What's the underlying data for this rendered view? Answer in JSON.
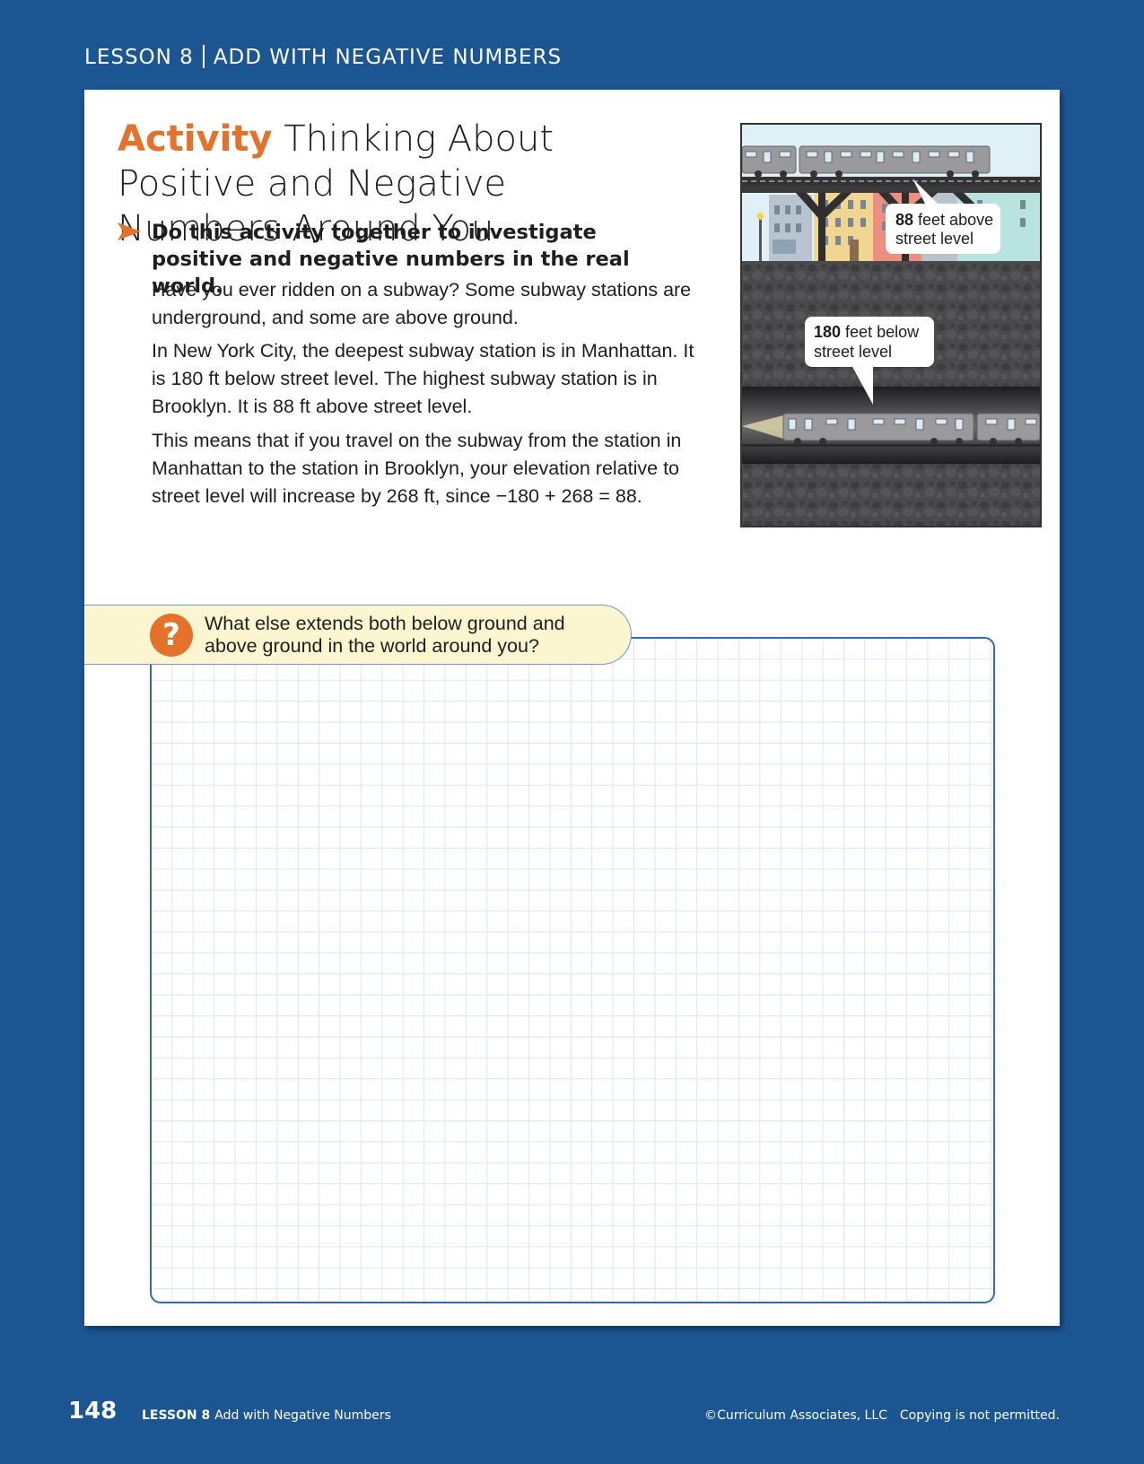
{
  "header": {
    "lesson_label": "LESSON 8",
    "lesson_title": "ADD WITH NEGATIVE NUMBERS"
  },
  "activity": {
    "label": "Activity",
    "title": "Thinking About Positive and Negative Numbers Around You",
    "instruction": "Do this activity together to investigate positive and negative numbers in the real world.",
    "paragraphs": [
      "Have you ever ridden on a subway? Some subway stations are underground, and some are above ground.",
      "In New York City, the deepest subway station is in Manhattan. It is 180 ft below street level. The highest subway station is in Brooklyn. It is 88 ft above street level.",
      "This means that if you travel on the subway from the station in Manhattan to the station in Brooklyn, your elevation relative to street level will increase by 268 ft, since −180 + 268 = 88."
    ]
  },
  "illustration": {
    "above_bold": "88",
    "above_rest": " feet above",
    "above_line2": "street level",
    "below_bold": "180",
    "below_rest": " feet below",
    "below_line2": "street level"
  },
  "prompt": {
    "icon": "?",
    "line1": "What else extends both below ground and",
    "line2": "above ground in the world around you?"
  },
  "footer": {
    "page_number": "148",
    "lesson_label": "LESSON 8",
    "lesson_title": "Add with Negative Numbers",
    "copyright": "©Curriculum Associates, LLC",
    "notice": "Copying is not permitted."
  },
  "colors": {
    "background": "#1b5592",
    "accent": "#e5722b",
    "prompt_bg": "#fbf6cf",
    "grid_border": "#2f6db3"
  }
}
